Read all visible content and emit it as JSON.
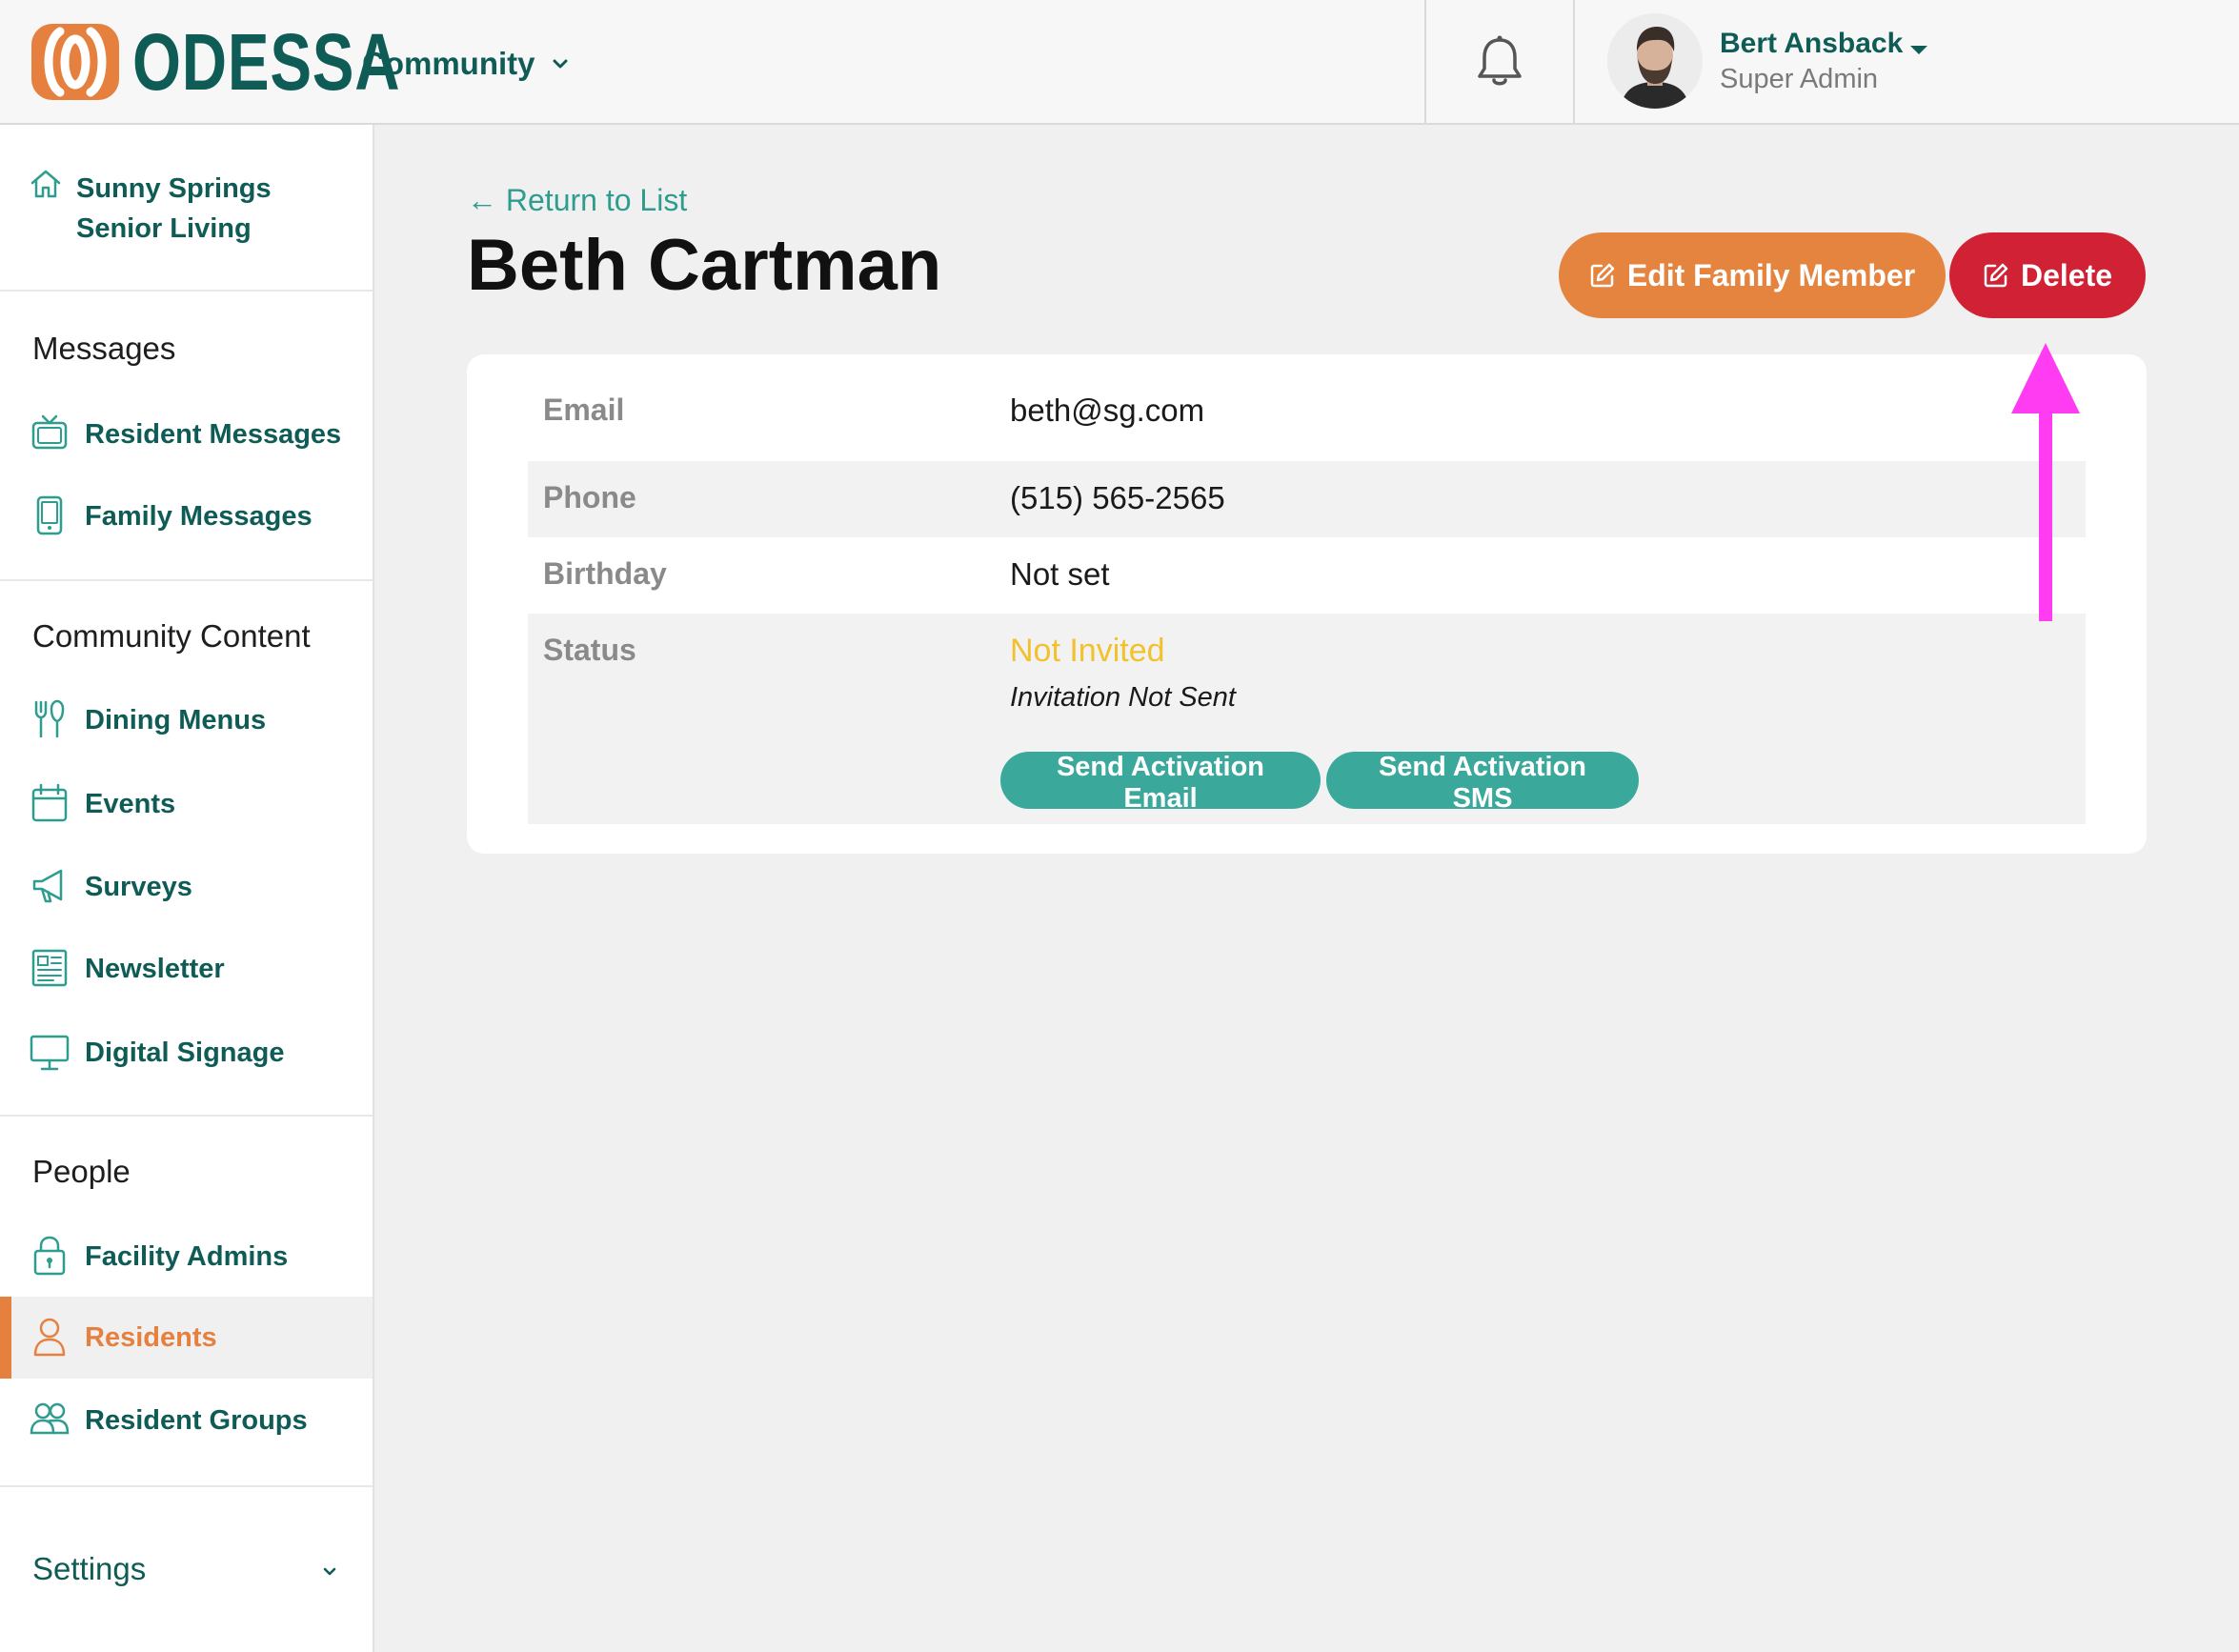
{
  "header": {
    "brand": "ODESSA",
    "community_label": "Community",
    "user": {
      "name": "Bert Ansback",
      "role": "Super Admin"
    }
  },
  "sidebar": {
    "facility_name": "Sunny Springs Senior Living",
    "sections": [
      {
        "title": "Messages",
        "items": [
          {
            "label": "Resident Messages",
            "icon": "tv-icon"
          },
          {
            "label": "Family Messages",
            "icon": "phone-icon"
          }
        ]
      },
      {
        "title": "Community Content",
        "items": [
          {
            "label": "Dining Menus",
            "icon": "utensils-icon"
          },
          {
            "label": "Events",
            "icon": "calendar-icon"
          },
          {
            "label": "Surveys",
            "icon": "megaphone-icon"
          },
          {
            "label": "Newsletter",
            "icon": "newspaper-icon"
          },
          {
            "label": "Digital Signage",
            "icon": "monitor-icon"
          }
        ]
      },
      {
        "title": "People",
        "items": [
          {
            "label": "Facility Admins",
            "icon": "lock-icon"
          },
          {
            "label": "Residents",
            "icon": "person-icon",
            "active": true
          },
          {
            "label": "Resident Groups",
            "icon": "people-group-icon"
          }
        ]
      }
    ],
    "settings_label": "Settings"
  },
  "main": {
    "return_link": "← Return to List",
    "title": "Beth Cartman",
    "edit_button": "Edit Family Member",
    "delete_button": "Delete",
    "details": [
      {
        "key": "Email",
        "value": "beth@sg.com"
      },
      {
        "key": "Phone",
        "value": "(515) 565-2565"
      },
      {
        "key": "Birthday",
        "value": "Not set"
      }
    ],
    "status": {
      "key": "Status",
      "value": "Not Invited",
      "sub": "Invitation Not Sent",
      "send_email_button": "Send Activation Email",
      "send_sms_button": "Send Activation SMS"
    }
  },
  "colors": {
    "brand_teal": "#0f5c57",
    "accent_orange": "#e5803f",
    "delete_red": "#d02234",
    "pill_teal": "#3aa89b",
    "status_yellow": "#f2c12e",
    "annotation_magenta": "#ff3cf2"
  }
}
